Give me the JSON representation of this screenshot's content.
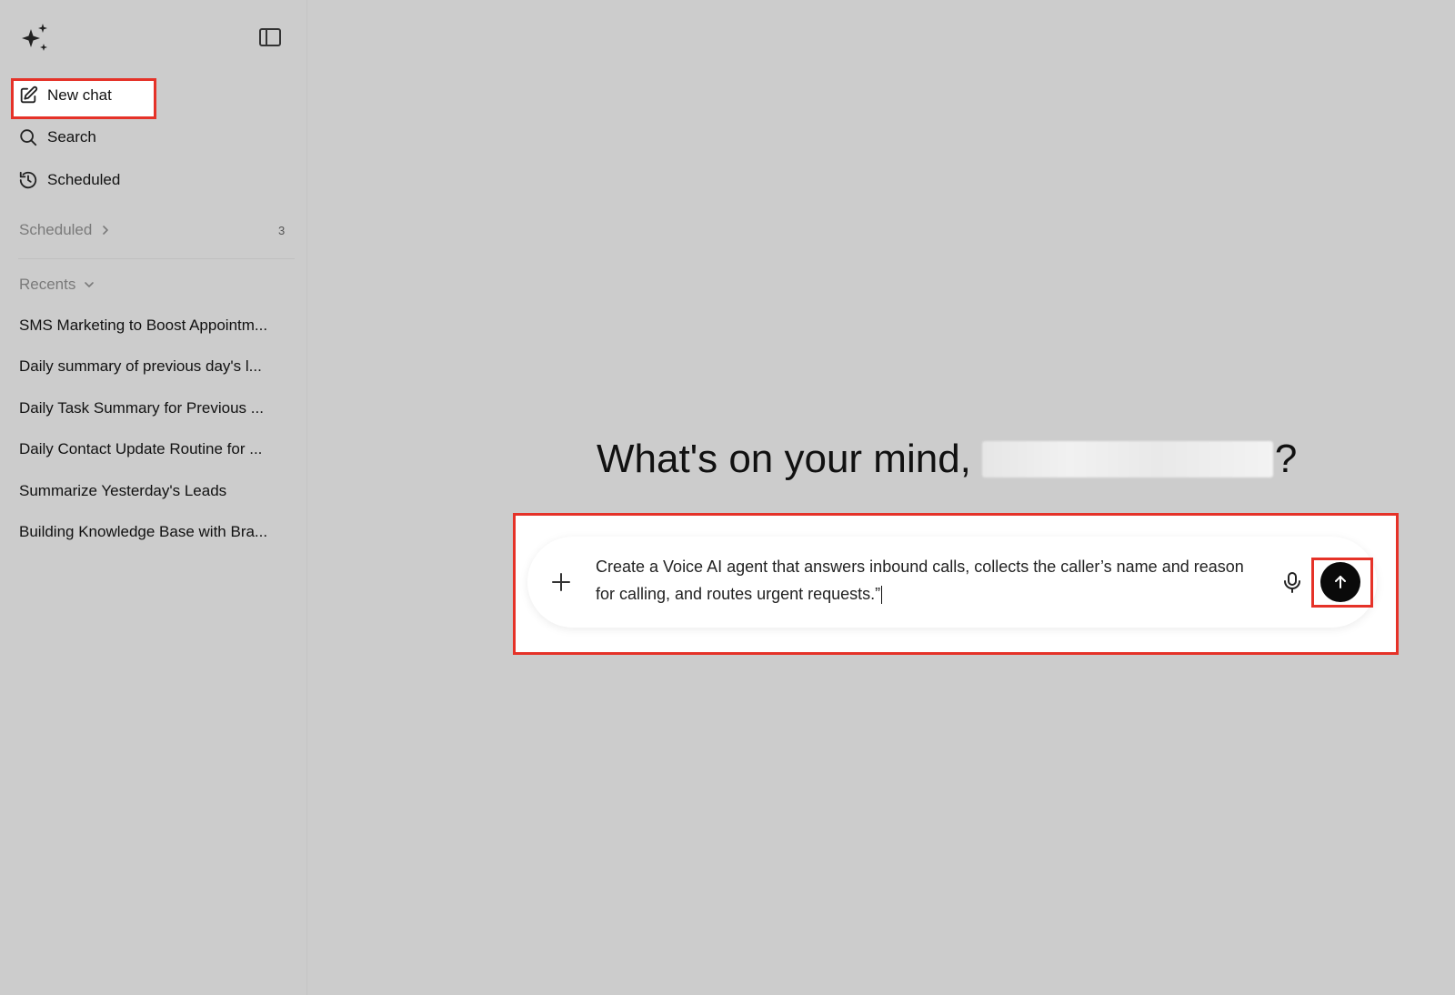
{
  "sidebar": {
    "new_chat": "New chat",
    "search": "Search",
    "scheduled_nav": "Scheduled",
    "scheduled_section": "Scheduled",
    "scheduled_count": "3",
    "recents_section": "Recents",
    "recents": [
      "SMS Marketing to Boost Appointm...",
      "Daily summary of previous day's l...",
      "Daily Task Summary for Previous ...",
      "Daily Contact Update Routine for ...",
      "Summarize Yesterday's Leads",
      "Building Knowledge Base with Bra..."
    ]
  },
  "main": {
    "greeting_prefix": "What's on your mind,",
    "greeting_suffix": "?",
    "prompt_text": "Create a Voice AI agent that answers inbound calls, collects the caller’s name and reason for calling, and routes urgent requests.”"
  },
  "icons": {
    "logo": "sparkles-icon",
    "toggle": "sidebar-toggle-icon",
    "new_chat": "edit-icon",
    "search": "search-icon",
    "scheduled": "clock-refresh-icon",
    "plus": "plus-icon",
    "mic": "microphone-icon",
    "send": "arrow-up-icon"
  },
  "colors": {
    "background": "#cccccc",
    "highlight": "#e53228",
    "send_button": "#0a0a0a"
  }
}
